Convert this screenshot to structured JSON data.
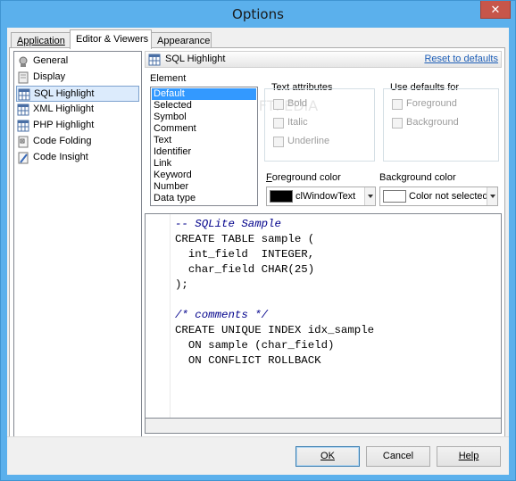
{
  "window": {
    "title": "Options",
    "close_glyph": "✕"
  },
  "tabs": [
    {
      "label": "Application",
      "active": false
    },
    {
      "label": "Editor & Viewers",
      "active": true
    },
    {
      "label": "Appearance",
      "active": false
    }
  ],
  "sidebar": {
    "items": [
      {
        "label": "General",
        "icon": "general-icon"
      },
      {
        "label": "Display",
        "icon": "display-icon"
      },
      {
        "label": "SQL Highlight",
        "icon": "grid-icon",
        "selected": true
      },
      {
        "label": "XML Highlight",
        "icon": "grid-icon"
      },
      {
        "label": "PHP Highlight",
        "icon": "grid-icon"
      },
      {
        "label": "Code Folding",
        "icon": "folding-icon"
      },
      {
        "label": "Code Insight",
        "icon": "insight-icon"
      }
    ]
  },
  "panel": {
    "title": "SQL Highlight",
    "reset_label": "Reset to defaults"
  },
  "element": {
    "label": "Element",
    "items": [
      "Default",
      "Selected",
      "Symbol",
      "Comment",
      "Text",
      "Identifier",
      "Link",
      "Keyword",
      "Number",
      "Data type"
    ],
    "selected": "Default"
  },
  "text_attributes": {
    "label": "Text attributes",
    "bold": "Bold",
    "italic": "Italic",
    "underline": "Underline"
  },
  "use_defaults": {
    "label": "Use defaults for",
    "foreground": "Foreground",
    "background": "Background"
  },
  "foreground_color": {
    "label": "Foreground color",
    "value": "clWindowText",
    "swatch": "#000000"
  },
  "background_color": {
    "label": "Background color",
    "value": "Color not selected",
    "swatch": "#ffffff"
  },
  "code_sample": [
    "-- SQLite Sample",
    "CREATE TABLE sample (",
    "  int_field  INTEGER,",
    "  char_field CHAR(25)",
    ");",
    "",
    "/* comments */",
    "CREATE UNIQUE INDEX idx_sample",
    "  ON sample (char_field)",
    "  ON CONFLICT ROLLBACK"
  ],
  "buttons": {
    "ok": "OK",
    "cancel": "Cancel",
    "help": "Help"
  },
  "watermark": "SOFTPEDIA",
  "colors": {
    "titlebar": "#5bb0ec",
    "close": "#c7564a",
    "selection": "#3399ff",
    "comment": "#00008b",
    "link": "#1f5fb7"
  }
}
